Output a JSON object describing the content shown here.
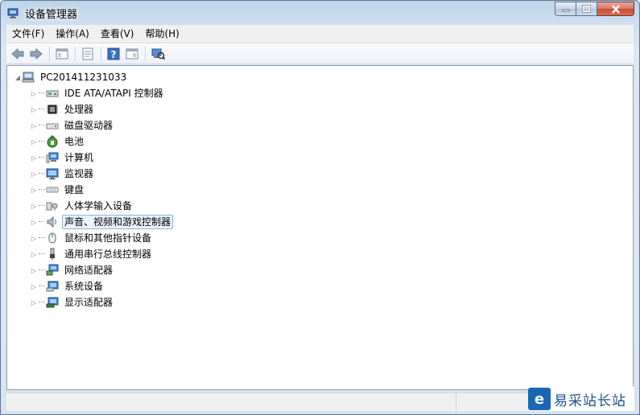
{
  "window": {
    "title": "设备管理器",
    "icon": "device-manager-icon",
    "controls": [
      "minimize-icon",
      "maximize-icon",
      "close-icon"
    ]
  },
  "menu": [
    {
      "label": "文件(F)"
    },
    {
      "label": "操作(A)"
    },
    {
      "label": "查看(V)"
    },
    {
      "label": "帮助(H)"
    }
  ],
  "toolbar": [
    "back-icon",
    "forward-icon",
    "show-hide-tree-icon",
    "properties-icon",
    "help-icon",
    "action-pane-icon",
    "scan-hardware-icon"
  ],
  "tree": {
    "root": {
      "label": "PC201411231033",
      "icon": "computer-icon"
    },
    "items": [
      {
        "label": "IDE ATA/ATAPI 控制器",
        "icon": "ide-controller-icon"
      },
      {
        "label": "处理器",
        "icon": "processor-icon"
      },
      {
        "label": "磁盘驱动器",
        "icon": "disk-drive-icon"
      },
      {
        "label": "电池",
        "icon": "battery-icon"
      },
      {
        "label": "计算机",
        "icon": "computer-icon"
      },
      {
        "label": "监视器",
        "icon": "monitor-icon"
      },
      {
        "label": "键盘",
        "icon": "keyboard-icon"
      },
      {
        "label": "人体学输入设备",
        "icon": "hid-icon"
      },
      {
        "label": "声音、视频和游戏控制器",
        "icon": "speaker-icon",
        "selected": true
      },
      {
        "label": "鼠标和其他指针设备",
        "icon": "mouse-icon"
      },
      {
        "label": "通用串行总线控制器",
        "icon": "usb-icon"
      },
      {
        "label": "网络适配器",
        "icon": "network-adapter-icon"
      },
      {
        "label": "系统设备",
        "icon": "system-device-icon"
      },
      {
        "label": "显示适配器",
        "icon": "display-adapter-icon"
      }
    ]
  },
  "watermark": {
    "logo": "e",
    "text": "易采站长站"
  },
  "colors": {
    "selection_bg": "#eaf3fc",
    "selection_border": "#8fb3da",
    "close_red": "#c84a3a"
  }
}
